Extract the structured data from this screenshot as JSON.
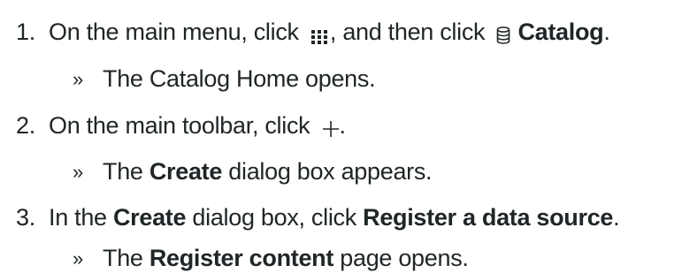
{
  "steps": [
    {
      "number": "1.",
      "segments": [
        "On the main menu, click ",
        ", and then click ",
        "Catalog",
        "."
      ],
      "icons": [
        "grid-icon",
        "database-icon"
      ],
      "result_marker": "»",
      "result": [
        "The Catalog Home opens."
      ]
    },
    {
      "number": "2.",
      "segments": [
        "On the main toolbar, click ",
        "."
      ],
      "icons": [
        "plus-icon"
      ],
      "result_marker": "»",
      "result": [
        "The ",
        "Create",
        " dialog box appears."
      ]
    },
    {
      "number": "3.",
      "segments": [
        "In the ",
        "Create",
        " dialog box, click ",
        "Register a data source",
        "."
      ],
      "icons": [],
      "result_marker": "»",
      "result": [
        "The ",
        "Register content",
        " page opens."
      ]
    }
  ]
}
